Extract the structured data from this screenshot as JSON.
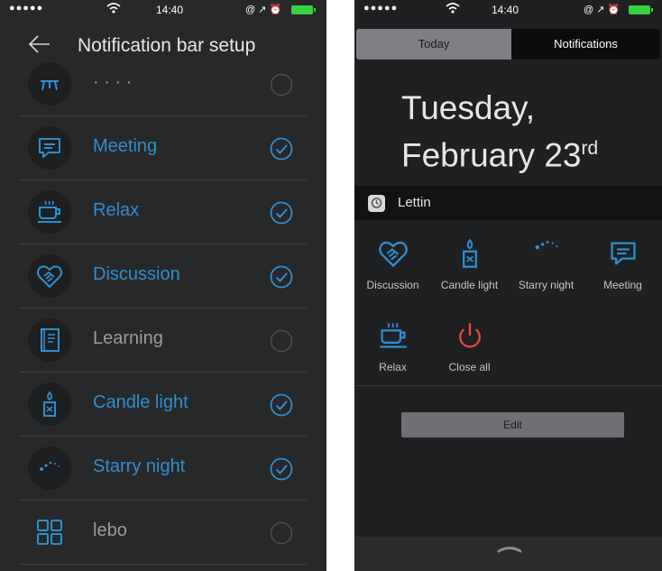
{
  "left": {
    "status": {
      "carrier_dots": "●●●●●",
      "time": "14:40",
      "status_icons": "@ ↗ ⏰"
    },
    "header": {
      "title": "Notification bar setup"
    },
    "rows": [
      {
        "label": "· · · ·",
        "checked": false
      },
      {
        "label": "Meeting",
        "checked": true
      },
      {
        "label": "Relax",
        "checked": true
      },
      {
        "label": "Discussion",
        "checked": true
      },
      {
        "label": "Learning",
        "checked": false
      },
      {
        "label": "Candle light",
        "checked": true
      },
      {
        "label": "Starry night",
        "checked": true
      },
      {
        "label": "lebo",
        "checked": false
      }
    ]
  },
  "right": {
    "status": {
      "carrier_dots": "●●●●●",
      "time": "14:40",
      "status_icons": "@ ↗ ⏰"
    },
    "tabs": {
      "today": "Today",
      "notifications": "Notifications"
    },
    "date": {
      "line1": "Tuesday,",
      "line2": "February 23",
      "suffix": "rd"
    },
    "app": {
      "name": "Lettin"
    },
    "widgets": [
      {
        "label": "Discussion"
      },
      {
        "label": "Candle light"
      },
      {
        "label": "Starry night"
      },
      {
        "label": "Meeting"
      },
      {
        "label": "Relax"
      },
      {
        "label": "Close all"
      }
    ],
    "edit_label": "Edit"
  },
  "colors": {
    "accent": "#2e8fcf",
    "close_red": "#e84a3f",
    "battery": "#35d244"
  }
}
